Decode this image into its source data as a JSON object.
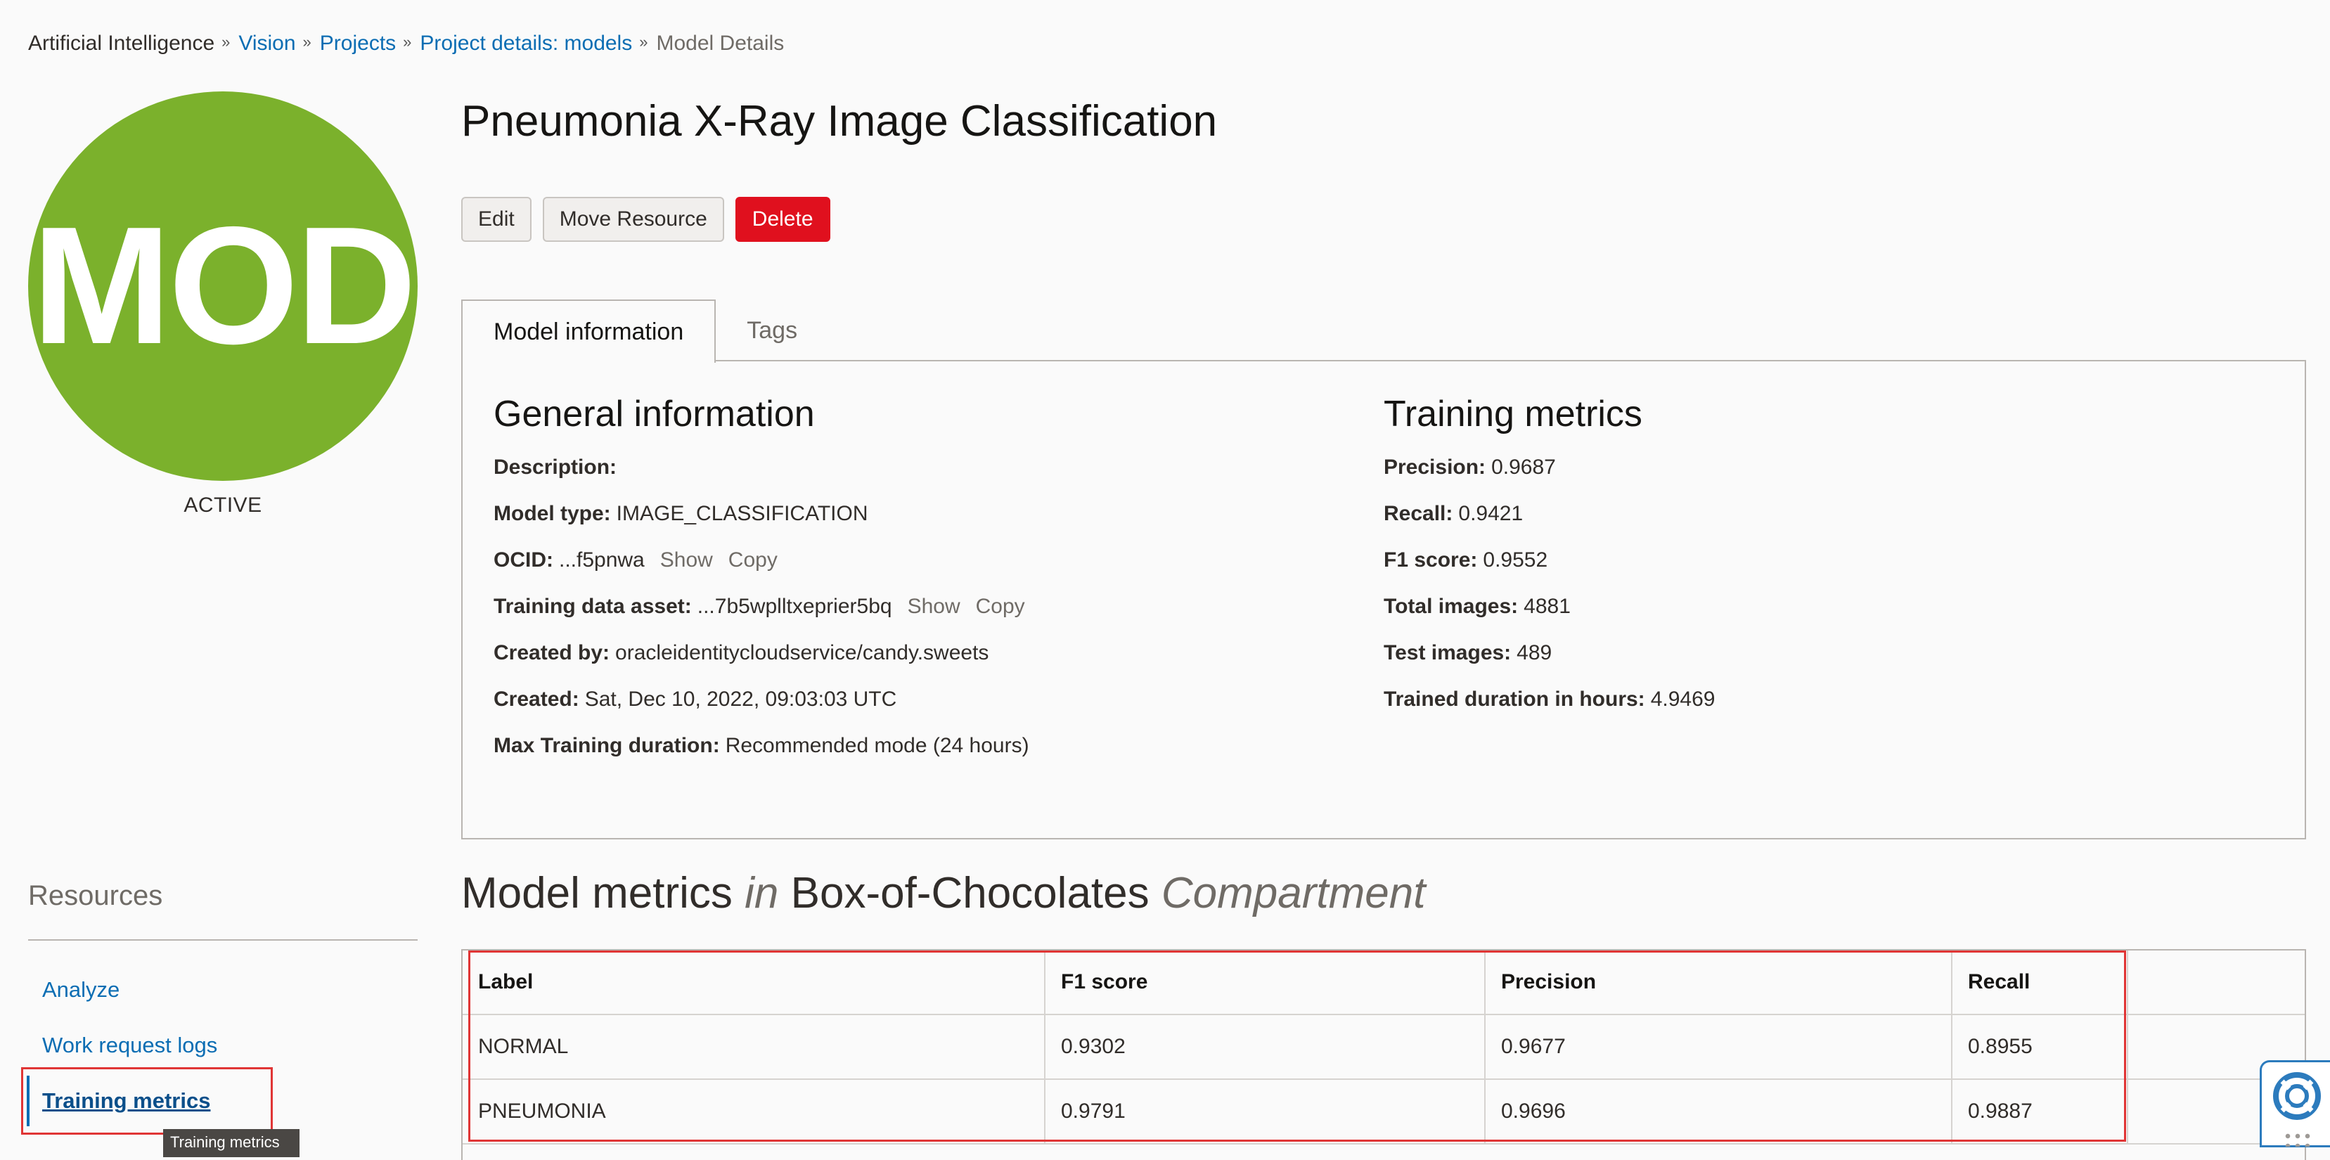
{
  "breadcrumb": {
    "items": [
      {
        "label": "Artificial Intelligence"
      },
      {
        "label": "Vision"
      },
      {
        "label": "Projects"
      },
      {
        "label": "Project details: models"
      },
      {
        "label": "Model Details"
      }
    ],
    "separator": "»"
  },
  "avatar": {
    "text": "MOD",
    "color": "#7bb12c"
  },
  "status": "ACTIVE",
  "title": "Pneumonia X-Ray Image Classification",
  "actions": {
    "edit": "Edit",
    "move": "Move Resource",
    "delete": "Delete"
  },
  "tabs": [
    {
      "label": "Model information",
      "active": true
    },
    {
      "label": "Tags",
      "active": false
    }
  ],
  "general": {
    "title": "General information",
    "description_label": "Description:",
    "model_type_label": "Model type:",
    "model_type": "IMAGE_CLASSIFICATION",
    "ocid_label": "OCID:",
    "ocid": "...f5pnwa",
    "show": "Show",
    "copy": "Copy",
    "asset_label": "Training data asset:",
    "asset": "...7b5wplltxeprier5bq",
    "created_by_label": "Created by:",
    "created_by": "oracleidentitycloudservice/candy.sweets",
    "created_label": "Created:",
    "created": "Sat, Dec 10, 2022, 09:03:03 UTC",
    "max_label": "Max Training duration:",
    "max": "Recommended mode (24 hours)"
  },
  "training": {
    "title": "Training metrics",
    "precision_label": "Precision:",
    "precision": "0.9687",
    "recall_label": "Recall:",
    "recall": "0.9421",
    "f1_label": "F1 score:",
    "f1": "0.9552",
    "total_label": "Total images:",
    "total": "4881",
    "test_label": "Test images:",
    "test": "489",
    "duration_label": "Trained duration in hours:",
    "duration": "4.9469"
  },
  "resources": {
    "title": "Resources",
    "items": [
      "Analyze",
      "Work request logs",
      "Training metrics"
    ],
    "tooltip": "Training metrics"
  },
  "metrics": {
    "title_a": "Model metrics",
    "title_in": "in",
    "title_b": "Box-of-Chocolates",
    "title_c": "Compartment",
    "columns": [
      "Label",
      "F1 score",
      "Precision",
      "Recall"
    ],
    "rows": [
      [
        "NORMAL",
        "0.9302",
        "0.9677",
        "0.8955"
      ],
      [
        "PNEUMONIA",
        "0.9791",
        "0.9696",
        "0.9887"
      ]
    ]
  },
  "colors": {
    "link": "#0b6db3",
    "danger": "#e0101e",
    "highlight": "#e03535"
  },
  "icons": {
    "help": "lifebuoy-icon"
  }
}
